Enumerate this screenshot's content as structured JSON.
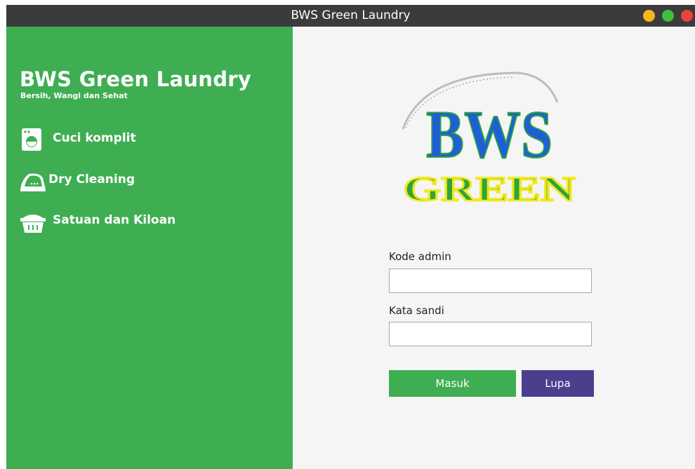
{
  "window": {
    "title": "BWS Green  Laundry"
  },
  "sidebar": {
    "brand": "BWS Green Laundry",
    "tagline": "Bersih, Wangi dan Sehat",
    "items": [
      {
        "label": "Cuci komplit",
        "icon": "washing-machine-icon"
      },
      {
        "label": "Dry Cleaning",
        "icon": "iron-icon"
      },
      {
        "label": "Satuan dan Kiloan",
        "icon": "laundry-basket-icon"
      }
    ]
  },
  "logo": {
    "top_text": "BWS",
    "bottom_text": "GREEN"
  },
  "form": {
    "kode_label": "Kode admin",
    "kode_value": "",
    "sandi_label": "Kata sandi",
    "sandi_value": "",
    "masuk_label": "Masuk",
    "lupa_label": "Lupa"
  },
  "colors": {
    "sidebar_bg": "#3fae52",
    "masuk_bg": "#3fae52",
    "lupa_bg": "#4a3f8f",
    "titlebar_bg": "#3b3b3b",
    "logo_blue": "#1f5fd6",
    "logo_yellow": "#f2e81f",
    "logo_green": "#2ea43c"
  }
}
